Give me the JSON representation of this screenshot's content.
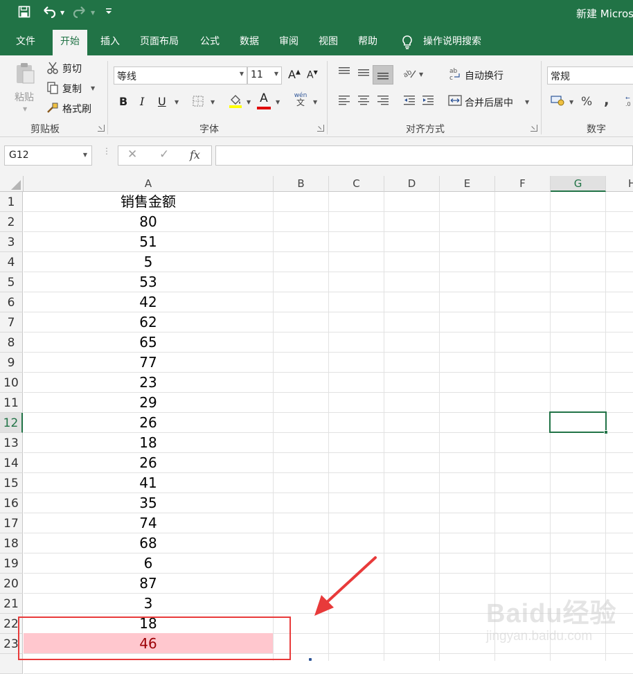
{
  "window": {
    "title": "新建 Micros"
  },
  "quick_access": {
    "save_icon": "save-icon",
    "undo_icon": "undo-icon",
    "redo_icon": "redo-icon",
    "customize_icon": "customize-qat-icon"
  },
  "tabs": [
    {
      "label": "文件"
    },
    {
      "label": "开始",
      "active": true
    },
    {
      "label": "插入"
    },
    {
      "label": "页面布局"
    },
    {
      "label": "公式"
    },
    {
      "label": "数据"
    },
    {
      "label": "审阅"
    },
    {
      "label": "视图"
    },
    {
      "label": "帮助"
    }
  ],
  "tell_me": {
    "label": "操作说明搜索"
  },
  "ribbon": {
    "clipboard": {
      "label": "剪贴板",
      "paste": "粘贴",
      "cut": "剪切",
      "copy": "复制",
      "format_painter": "格式刷"
    },
    "font": {
      "label": "字体",
      "font_name": "等线",
      "font_size": "11",
      "grow_glyph": "A",
      "shrink_glyph": "A",
      "bold": "B",
      "italic": "I",
      "underline": "U",
      "font_color_glyph": "A",
      "phonetic_top": "wén",
      "phonetic_bottom": "文",
      "highlight_color": "#ffff00",
      "font_color": "#e00000"
    },
    "alignment": {
      "label": "对齐方式",
      "wrap_text": "自动换行",
      "merge_center": "合并后居中"
    },
    "number": {
      "label": "数字",
      "format": "常规",
      "percent": "%",
      "comma": ","
    }
  },
  "formula_bar": {
    "name_box": "G12",
    "cancel_glyph": "✕",
    "enter_glyph": "✓",
    "fx_glyph": "fx",
    "value": ""
  },
  "columns": [
    "A",
    "B",
    "C",
    "D",
    "E",
    "F",
    "G",
    "H"
  ],
  "selected_column": "G",
  "selected_row": "12",
  "rows": [
    {
      "num": "1",
      "a": "销售金额"
    },
    {
      "num": "2",
      "a": "80"
    },
    {
      "num": "3",
      "a": "51"
    },
    {
      "num": "4",
      "a": "5"
    },
    {
      "num": "5",
      "a": "53"
    },
    {
      "num": "6",
      "a": "42"
    },
    {
      "num": "7",
      "a": "62"
    },
    {
      "num": "8",
      "a": "65"
    },
    {
      "num": "9",
      "a": "77"
    },
    {
      "num": "10",
      "a": "23"
    },
    {
      "num": "11",
      "a": "29"
    },
    {
      "num": "12",
      "a": "26"
    },
    {
      "num": "13",
      "a": "18"
    },
    {
      "num": "14",
      "a": "26"
    },
    {
      "num": "15",
      "a": "41"
    },
    {
      "num": "16",
      "a": "35"
    },
    {
      "num": "17",
      "a": "74"
    },
    {
      "num": "18",
      "a": "68"
    },
    {
      "num": "19",
      "a": "6"
    },
    {
      "num": "20",
      "a": "87"
    },
    {
      "num": "21",
      "a": "3"
    },
    {
      "num": "22",
      "a": "18"
    },
    {
      "num": "23",
      "a": "46"
    }
  ],
  "highlight": {
    "fill": "#ffc7ce",
    "text": "#9c0006"
  },
  "annotation": {
    "box_color": "#e83a3a",
    "arrow_color": "#e83a3a"
  },
  "watermark": {
    "brand": "Baidu经验",
    "url": "jingyan.baidu.com"
  },
  "colors": {
    "excel_green": "#217346",
    "ribbon_bg": "#f3f3f3"
  }
}
